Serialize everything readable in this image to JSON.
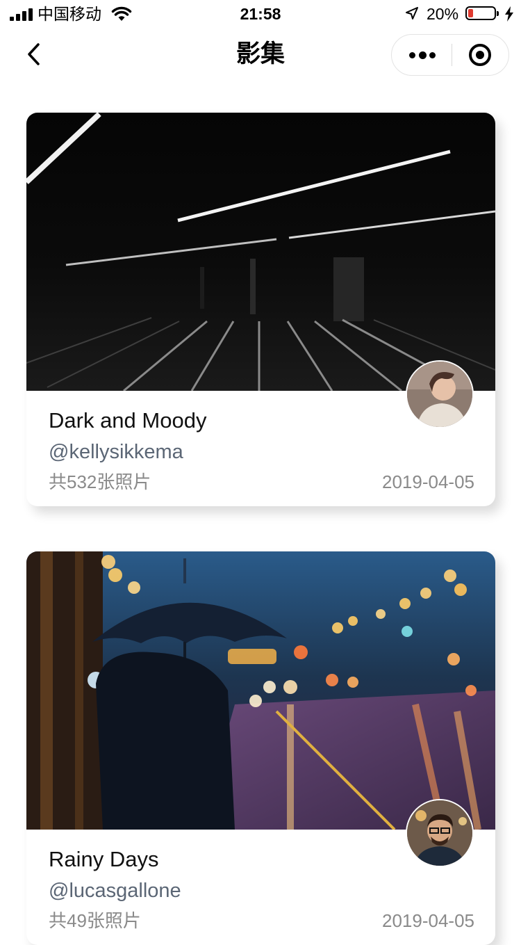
{
  "status_bar": {
    "carrier": "中国移动",
    "time": "21:58",
    "battery_percent": "20%",
    "battery_level": 0.2,
    "battery_color": "#e03a2f"
  },
  "nav": {
    "title": "影集",
    "back_icon": "chevron-left-icon",
    "more_icon": "more-dots-icon",
    "close_icon": "target-close-icon"
  },
  "albums": [
    {
      "title": "Dark and Moody",
      "author": "@kellysikkema",
      "count": "共532张照片",
      "date": "2019-04-05"
    },
    {
      "title": "Rainy Days",
      "author": "@lucasgallone",
      "count": "共49张照片",
      "date": "2019-04-05"
    }
  ],
  "colors": {
    "author": "#5b6675",
    "meta": "#8a8a8a"
  }
}
